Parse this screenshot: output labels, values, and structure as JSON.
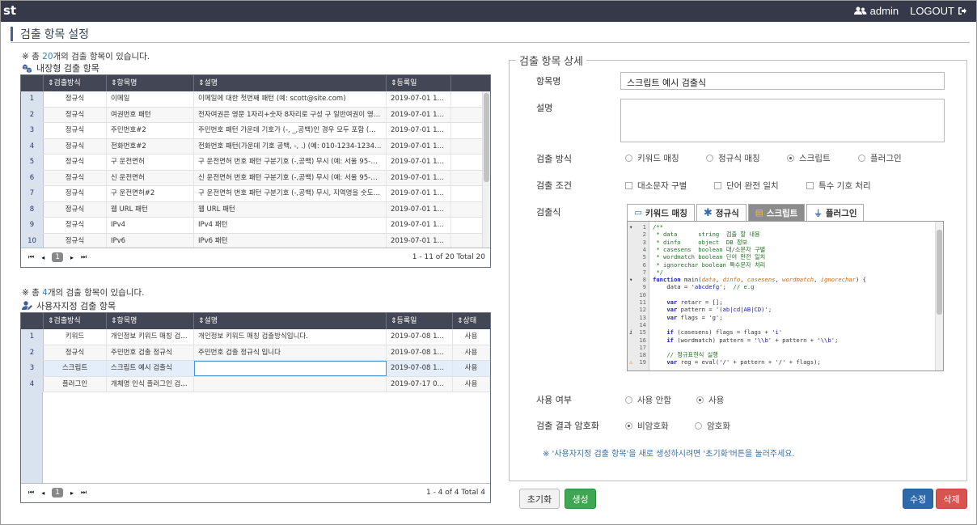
{
  "header": {
    "logo": "st",
    "user": "admin",
    "logout": "LOGOUT"
  },
  "page_title": "검출 항목 설정",
  "builtin": {
    "note_prefix": "※ 총 ",
    "count": "20",
    "note_suffix": "개의 검출 항목이 있습니다.",
    "title": "내장형 검출 항목",
    "columns": [
      "검출방식",
      "항목명",
      "설명",
      "등록일"
    ],
    "rows": [
      {
        "no": "1",
        "type": "정규식",
        "name": "이메일",
        "desc": "이메일에 대한 첫번째 패턴 (예: scott@site.com)",
        "date": "2019-07-01 11:…"
      },
      {
        "no": "2",
        "type": "정규식",
        "name": "여권번호 패턴",
        "desc": "전자여권은 영문 1자리+숫자 8자리로 구성 구 일반여권이 영문 …",
        "date": "2019-07-01 11:…"
      },
      {
        "no": "3",
        "type": "정규식",
        "name": "주민번호#2",
        "desc": "주민번호 패턴 가운데 기호가 (-, _,공백)인 경우 모두 포함 (예: …",
        "date": "2019-07-01 11:…"
      },
      {
        "no": "4",
        "type": "정규식",
        "name": "전화번호#2",
        "desc": "전화번호 패턴(가운데 기호 공백, -, .) (예: 010-1234-1234, 0…",
        "date": "2019-07-01 11:…"
      },
      {
        "no": "5",
        "type": "정규식",
        "name": "구 운전면허",
        "desc": "구 운전면허 번호 패턴 구분기호 (-,공백) 무시 (예: 서울 95-255…",
        "date": "2019-07-01 11:…"
      },
      {
        "no": "6",
        "type": "정규식",
        "name": "신 운전면허",
        "desc": "신 운전면허 번호 패턴 구분기호 (-,공백) 무시 (예: 서울 95-255…",
        "date": "2019-07-01 11:…"
      },
      {
        "no": "7",
        "type": "정규식",
        "name": "구 운전면허#2",
        "desc": "구 운전면허 번호 패턴 구분기호 (-,공백) 무시, 지역명을 숫도 유…",
        "date": "2019-07-01 11:…"
      },
      {
        "no": "8",
        "type": "정규식",
        "name": "웹 URL 패턴",
        "desc": "웹 URL 패턴",
        "date": "2019-07-01 11:…"
      },
      {
        "no": "9",
        "type": "정규식",
        "name": "IPv4",
        "desc": "IPv4 패턴",
        "date": "2019-07-01 11:…"
      },
      {
        "no": "10",
        "type": "정규식",
        "name": "IPv6",
        "desc": "IPv6 패턴",
        "date": "2019-07-01 11:…"
      }
    ],
    "page": "1",
    "info": "1 - 11 of 20   Total 20"
  },
  "custom": {
    "note_prefix": "※ 총 ",
    "count": "4",
    "note_suffix": "개의 검출 항목이 있습니다.",
    "title": "사용자지정 검출 항목",
    "columns": [
      "검출방식",
      "항목명",
      "설명",
      "등록일",
      "상태"
    ],
    "rows": [
      {
        "no": "1",
        "type": "키워드",
        "name": "개인정보 키워드 매칭 검…",
        "desc": "개인정보 키워드 매칭 검출방식입니다.",
        "date": "2019-07-08 13:…",
        "status": "사용"
      },
      {
        "no": "2",
        "type": "정규식",
        "name": "주민번호 검출 정규식",
        "desc": "주민번호 검출 정규식 입니다",
        "date": "2019-07-08 13:…",
        "status": "사용"
      },
      {
        "no": "3",
        "type": "스크립트",
        "name": "스크립트 예시 검출식",
        "desc": "",
        "date": "2019-07-08 15:…",
        "status": "사용"
      },
      {
        "no": "4",
        "type": "플러그인",
        "name": "개체명 인식 플러그인 검…",
        "desc": "",
        "date": "2019-07-17 09:…",
        "status": "사용"
      }
    ],
    "page": "1",
    "info": "1 - 4 of 4   Total 4"
  },
  "detail": {
    "legend": "검출 항목 상세",
    "name_label": "항목명",
    "name_value": "스크립트 예시 검출식",
    "desc_label": "설명",
    "desc_value": "",
    "method_label": "검출 방식",
    "methods": [
      "키워드 매칭",
      "정규식 매칭",
      "스크립트",
      "플러그인"
    ],
    "method_selected": 2,
    "cond_label": "검출 조건",
    "conditions": [
      "대소문자 구별",
      "단어 완전 일치",
      "특수 기호 처리"
    ],
    "expr_label": "검출식",
    "tabs": [
      "키워드 매칭",
      "정규식",
      "스크립트",
      "플러그인"
    ],
    "tab_active": 2,
    "code_lines": [
      {
        "n": "1",
        "m": "▾",
        "t": "/**",
        "c": "cm"
      },
      {
        "n": "2",
        "t": " * data      string  검출 할 내용",
        "c": "cm"
      },
      {
        "n": "3",
        "t": " * dinfo     object  DB 정보",
        "c": "cm"
      },
      {
        "n": "4",
        "t": " * casesens  boolean 대/소문자 구별",
        "c": "cm"
      },
      {
        "n": "5",
        "t": " * wordmatch boolean 단어 완전 일치",
        "c": "cm"
      },
      {
        "n": "6",
        "t": " * ignorechar boolean 특수문자 처리",
        "c": "cm"
      },
      {
        "n": "7",
        "t": " */",
        "c": "cm"
      },
      {
        "n": "8",
        "m": "▾",
        "parts": [
          [
            "kw",
            "function "
          ],
          [
            "",
            "main("
          ],
          [
            "pr",
            "data"
          ],
          [
            "",
            ", "
          ],
          [
            "pr",
            "dinfo"
          ],
          [
            "",
            ", "
          ],
          [
            "pr",
            "casesens"
          ],
          [
            "",
            ", "
          ],
          [
            "pr",
            "wordmatch"
          ],
          [
            "",
            ", "
          ],
          [
            "pr",
            "ignorechar"
          ],
          [
            "",
            ") {"
          ]
        ]
      },
      {
        "n": "9",
        "parts": [
          [
            "",
            "    data = "
          ],
          [
            "st",
            "'abcdefg'"
          ],
          [
            "",
            ";  "
          ],
          [
            "cm",
            "// e.g"
          ]
        ]
      },
      {
        "n": "10",
        "t": ""
      },
      {
        "n": "11",
        "parts": [
          [
            "",
            "    "
          ],
          [
            "kw",
            "var"
          ],
          [
            "",
            " retarr = [];"
          ]
        ]
      },
      {
        "n": "12",
        "parts": [
          [
            "",
            "    "
          ],
          [
            "kw",
            "var"
          ],
          [
            "",
            " pattern = "
          ],
          [
            "st",
            "'(ab|cd|AB|CD)'"
          ],
          [
            "",
            ";"
          ]
        ]
      },
      {
        "n": "13",
        "parts": [
          [
            "",
            "    "
          ],
          [
            "kw",
            "var"
          ],
          [
            "",
            " flags = "
          ],
          [
            "st",
            "'g'"
          ],
          [
            "",
            ";"
          ]
        ]
      },
      {
        "n": "14",
        "t": ""
      },
      {
        "n": "15",
        "m": "i",
        "parts": [
          [
            "",
            "    "
          ],
          [
            "kw",
            "if"
          ],
          [
            "",
            " (casesens) flags = flags + "
          ],
          [
            "st",
            "'i'"
          ]
        ]
      },
      {
        "n": "16",
        "parts": [
          [
            "",
            "    "
          ],
          [
            "kw",
            "if"
          ],
          [
            "",
            " (wordmatch) pattern = "
          ],
          [
            "st",
            "'\\\\b'"
          ],
          [
            "",
            " + pattern + "
          ],
          [
            "st",
            "'\\\\b'"
          ],
          [
            "",
            ";"
          ]
        ]
      },
      {
        "n": "17",
        "t": ""
      },
      {
        "n": "18",
        "parts": [
          [
            "",
            "    "
          ],
          [
            "cm",
            "// 정규표현식 실행"
          ]
        ]
      },
      {
        "n": "19",
        "m": "⚠",
        "parts": [
          [
            "",
            "    "
          ],
          [
            "kw",
            "var"
          ],
          [
            "",
            " reg = eval("
          ],
          [
            "st",
            "'/'"
          ],
          [
            "",
            " + pattern + "
          ],
          [
            "st",
            "'/'"
          ],
          [
            "",
            " + flags);"
          ]
        ]
      }
    ],
    "use_label": "사용 여부",
    "use_options": [
      "사용 안함",
      "사용"
    ],
    "use_selected": 1,
    "enc_label": "검출 결과 암호화",
    "enc_options": [
      "비암호화",
      "암호화"
    ],
    "enc_selected": 0,
    "hint": "※ '사용자지정 검출 항목'을 새로 생성하시려면 '초기화'버튼을 눌러주세요."
  },
  "buttons": {
    "reset": "초기화",
    "create": "생성",
    "edit": "수정",
    "delete": "삭제"
  },
  "colors": {
    "topbar": "#35394a",
    "grid_header": "#434654",
    "create": "#3fa652",
    "edit": "#2f6aa8",
    "delete": "#d9534f",
    "accent": "#3a82b8"
  }
}
